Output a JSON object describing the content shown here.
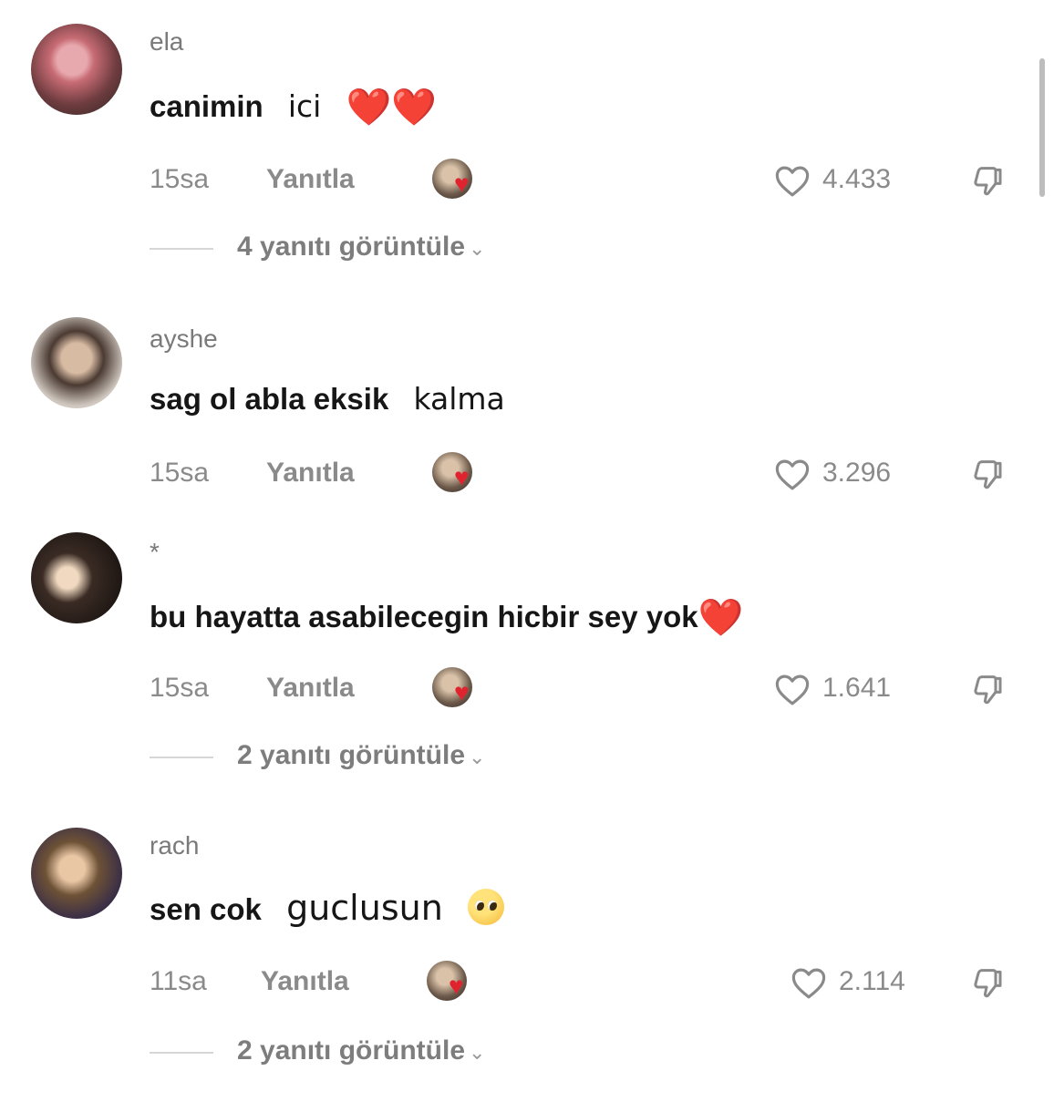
{
  "comments": [
    {
      "username": "ela",
      "text_bold": "canimin",
      "text_plain": "ici",
      "emoji": "❤️❤️",
      "time": "15sa",
      "reply_label": "Yanıtla",
      "likes": "4.433",
      "view_replies": "4 yanıtı görüntüle"
    },
    {
      "username": "ayshe",
      "text_bold": "sag ol abla eksik",
      "text_plain": "kalma",
      "time": "15sa",
      "reply_label": "Yanıtla",
      "likes": "3.296"
    },
    {
      "username": "*",
      "text_bold": "bu hayatta asabilecegin hicbir sey yok",
      "emoji": "❤️",
      "time": "15sa",
      "reply_label": "Yanıtla",
      "likes": "1.641",
      "view_replies": "2 yanıtı görüntüle"
    },
    {
      "username": "rach",
      "text_bold": "sen cok",
      "text_plain": "guclusun",
      "time": "11sa",
      "reply_label": "Yanıtla",
      "likes": "2.114",
      "view_replies": "2 yanıtı görüntüle"
    }
  ],
  "icons": {
    "like": "heart-outline-icon",
    "dislike": "thumbs-down-icon",
    "chevron": "chevron-down-icon",
    "creator_liked": "creator-liked-heart-icon"
  },
  "colors": {
    "text": "#161616",
    "muted": "#8a8a8a",
    "heart": "#e0242f"
  }
}
